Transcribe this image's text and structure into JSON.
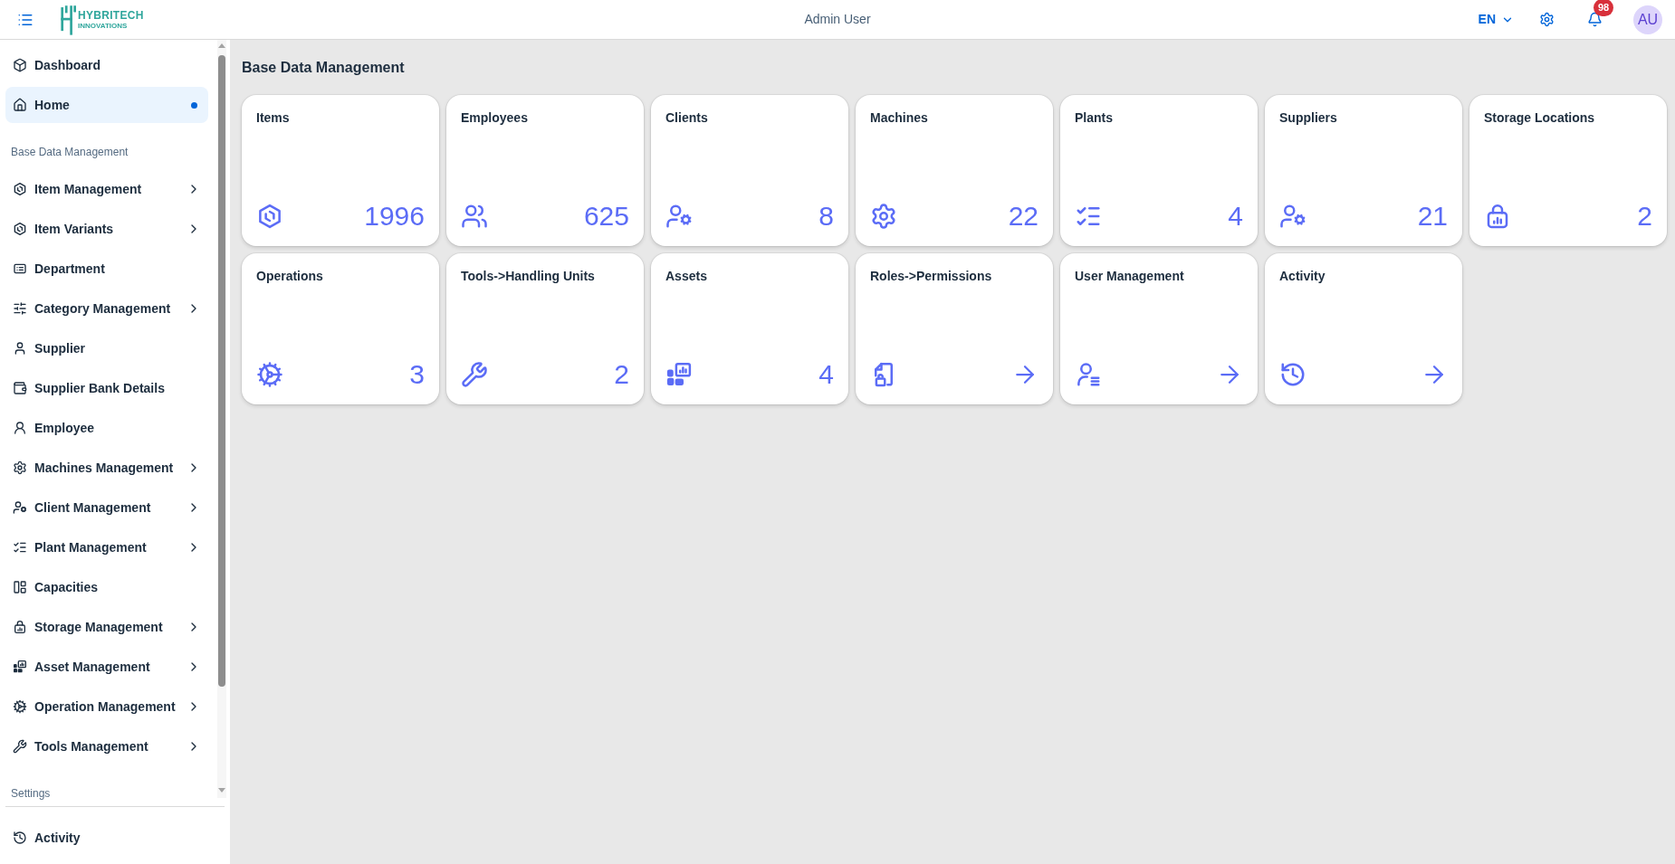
{
  "header": {
    "logo": {
      "wordmark": "HYBRITECH",
      "tagline": "INNOVATIONS"
    },
    "user_name": "Admin User",
    "language": "EN",
    "notification_count": "98",
    "avatar_initials": "AU"
  },
  "sidebar": {
    "items": [
      {
        "label": "Dashboard",
        "kind": "link",
        "selected": false
      },
      {
        "label": "Home",
        "kind": "link",
        "selected": true
      }
    ],
    "sections": [
      {
        "title": "Base Data Management",
        "items": [
          {
            "label": "Item Management",
            "kind": "group",
            "selected": false
          },
          {
            "label": "Item Variants",
            "kind": "group",
            "selected": false
          },
          {
            "label": "Department",
            "kind": "link",
            "selected": false
          },
          {
            "label": "Category Management",
            "kind": "group",
            "selected": false
          },
          {
            "label": "Supplier",
            "kind": "link",
            "selected": false
          },
          {
            "label": "Supplier Bank Details",
            "kind": "link",
            "selected": false
          },
          {
            "label": "Employee",
            "kind": "link",
            "selected": false
          },
          {
            "label": "Machines Management",
            "kind": "group",
            "selected": false
          },
          {
            "label": "Client Management",
            "kind": "group",
            "selected": false
          },
          {
            "label": "Plant Management",
            "kind": "group",
            "selected": false
          },
          {
            "label": "Capacities",
            "kind": "link",
            "selected": false
          },
          {
            "label": "Storage Management",
            "kind": "group",
            "selected": false
          },
          {
            "label": "Asset Management",
            "kind": "group",
            "selected": false
          },
          {
            "label": "Operation Management",
            "kind": "group",
            "selected": false
          },
          {
            "label": "Tools Management",
            "kind": "group",
            "selected": false
          }
        ]
      },
      {
        "title": "Settings"
      }
    ],
    "footer_items": [
      {
        "label": "Activity",
        "kind": "link",
        "selected": false
      }
    ]
  },
  "page_title": "Base Data Management",
  "cards": [
    {
      "title": "Items",
      "kind": "count",
      "value": "1996"
    },
    {
      "title": "Employees",
      "kind": "count",
      "value": "625"
    },
    {
      "title": "Clients",
      "kind": "count",
      "value": "8"
    },
    {
      "title": "Machines",
      "kind": "count",
      "value": "22"
    },
    {
      "title": "Plants",
      "kind": "count",
      "value": "4"
    },
    {
      "title": "Suppliers",
      "kind": "count",
      "value": "21"
    },
    {
      "title": "Storage Locations",
      "kind": "count",
      "value": "2"
    },
    {
      "title": "Operations",
      "kind": "count",
      "value": "3"
    },
    {
      "title": "Tools->Handling Units",
      "kind": "count",
      "value": "2"
    },
    {
      "title": "Assets",
      "kind": "count",
      "value": "4"
    },
    {
      "title": "Roles->Permissions",
      "kind": "link"
    },
    {
      "title": "User Management",
      "kind": "link"
    },
    {
      "title": "Activity",
      "kind": "link"
    }
  ]
}
